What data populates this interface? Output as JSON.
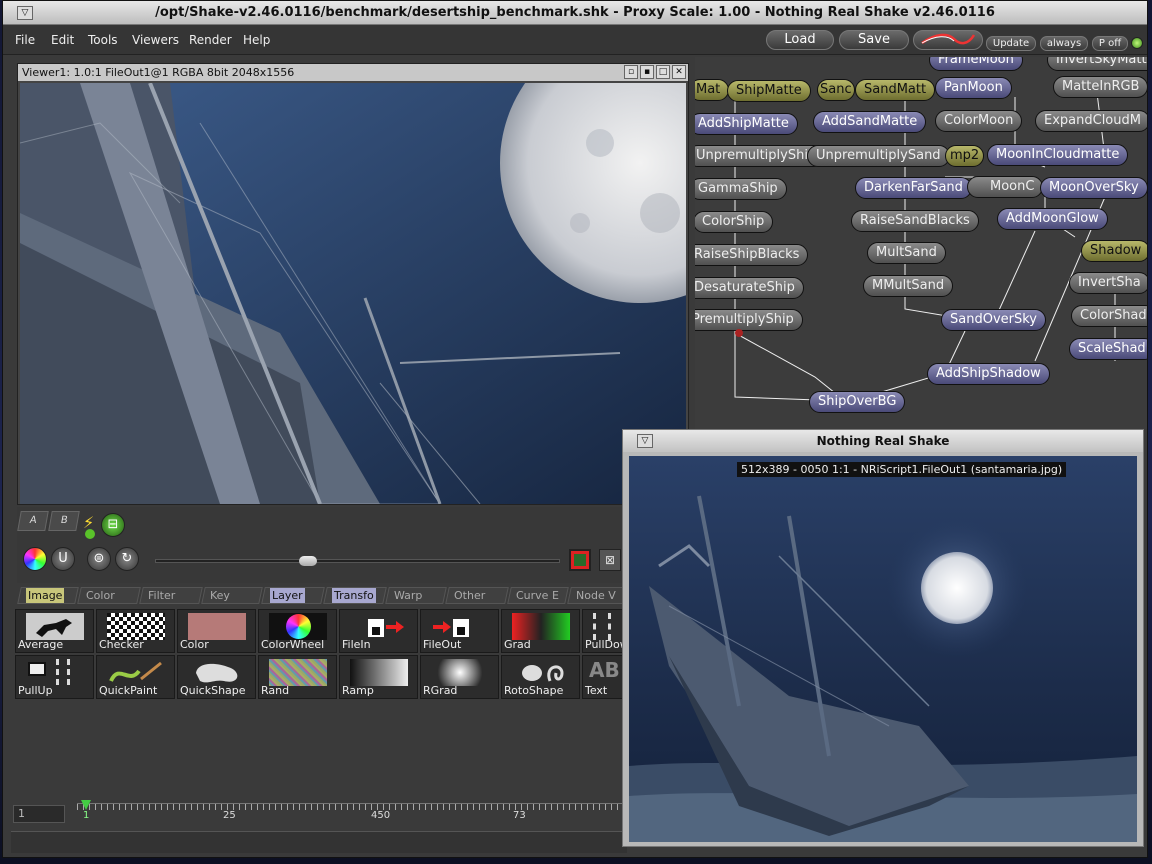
{
  "window": {
    "title": "/opt/Shake-v2.46.0116/benchmark/desertship_benchmark.shk - Proxy Scale: 1.00 - Nothing Real Shake v2.46.0116",
    "menu_button": "▽"
  },
  "menu": [
    "File",
    "Edit",
    "Tools",
    "Viewers",
    "Render",
    "Help"
  ],
  "top_buttons": {
    "load": "Load",
    "save": "Save",
    "update": "Update",
    "always": "always",
    "proxy": "P off"
  },
  "viewer": {
    "header": "Viewer1: 1.0:1 FileOut1@1 RGBA 8bit 2048x1556",
    "tab_a": "A",
    "tab_b": "B"
  },
  "tool_tabs": [
    "Image",
    "Color",
    "Filter",
    "Key",
    "Layer",
    "Transfo",
    "Warp",
    "Other",
    "Curve E",
    "Node V"
  ],
  "tools": [
    "Average",
    "Checker",
    "Color",
    "ColorWheel",
    "FileIn",
    "FileOut",
    "Grad",
    "PullDow",
    "PullUp",
    "QuickPaint",
    "QuickShape",
    "Rand",
    "Ramp",
    "RGrad",
    "RotoShape",
    "Text"
  ],
  "timeline": {
    "frame_value": "1",
    "current": "1",
    "ticks": [
      "25",
      "450",
      "73"
    ]
  },
  "nodes": [
    {
      "label": "FrameMoon",
      "style": "blue"
    },
    {
      "label": "InvertSkyMatte",
      "style": "gray"
    },
    {
      "label": "Mat",
      "style": "olive"
    },
    {
      "label": "ShipMatte",
      "style": "olive"
    },
    {
      "label": "Sanc",
      "style": "olive"
    },
    {
      "label": "SandMatt",
      "style": "olive"
    },
    {
      "label": "PanMoon",
      "style": "blue"
    },
    {
      "label": "MatteInRGB",
      "style": "gray"
    },
    {
      "label": "AddShipMatte",
      "style": "blue"
    },
    {
      "label": "AddSandMatte",
      "style": "blue"
    },
    {
      "label": "ColorMoon",
      "style": "gray"
    },
    {
      "label": "ExpandCloudM",
      "style": "gray"
    },
    {
      "label": "UnpremultiplyShip",
      "style": "gray"
    },
    {
      "label": "UnpremultiplySand",
      "style": "gray"
    },
    {
      "label": "mp2",
      "style": "olive"
    },
    {
      "label": "MoonInCloudmatte",
      "style": "blue"
    },
    {
      "label": "GammaShip",
      "style": "gray"
    },
    {
      "label": "DarkenFarSand",
      "style": "blue"
    },
    {
      "label": "MoonC",
      "style": "gray"
    },
    {
      "label": "MoonOverSky",
      "style": "blue"
    },
    {
      "label": "ColorShip",
      "style": "gray"
    },
    {
      "label": "RaiseSandBlacks",
      "style": "gray"
    },
    {
      "label": "AddMoonGlow",
      "style": "blue"
    },
    {
      "label": "Shadow",
      "style": "olive"
    },
    {
      "label": "RaiseShipBlacks",
      "style": "gray"
    },
    {
      "label": "MultSand",
      "style": "gray"
    },
    {
      "label": "InvertSha",
      "style": "gray"
    },
    {
      "label": "DesaturateShip",
      "style": "gray"
    },
    {
      "label": "MMultSand",
      "style": "gray"
    },
    {
      "label": "ColorShad",
      "style": "gray"
    },
    {
      "label": "PremultiplyShip",
      "style": "gray"
    },
    {
      "label": "SandOverSky",
      "style": "blue"
    },
    {
      "label": "ScaleShad",
      "style": "blue"
    },
    {
      "label": "AddShipShadow",
      "style": "blue"
    },
    {
      "label": "ShipOverBG",
      "style": "blue"
    }
  ],
  "popup": {
    "title": "Nothing Real Shake",
    "caption": "512x389 - 0050 1:1 - NRiScript1.FileOut1 (santamaria.jpg)"
  }
}
